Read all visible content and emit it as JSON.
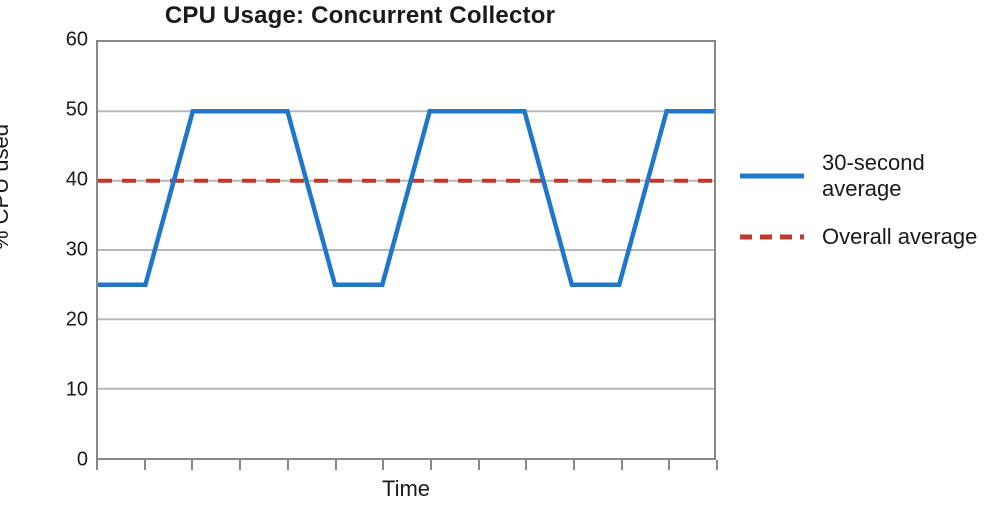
{
  "chart_data": {
    "type": "line",
    "title": "CPU Usage: Concurrent Collector",
    "xlabel": "Time",
    "ylabel": "% CPU used",
    "ylim": [
      0,
      60
    ],
    "y_ticks": [
      0,
      10,
      20,
      30,
      40,
      50,
      60
    ],
    "x_tick_count": 14,
    "series": [
      {
        "name": "30-second average",
        "style": "solid",
        "color": "#1f77c9",
        "x": [
          0,
          1,
          2,
          4,
          5,
          6,
          7,
          9,
          10,
          11,
          12,
          13
        ],
        "y": [
          25,
          25,
          50,
          50,
          25,
          25,
          50,
          50,
          25,
          25,
          50,
          50
        ]
      },
      {
        "name": "Overall average",
        "style": "dashed",
        "color": "#c0392b",
        "x": [
          0,
          13
        ],
        "y": [
          40,
          40
        ]
      }
    ],
    "xlim": [
      0,
      13
    ]
  },
  "title": "CPU Usage: Concurrent Collector",
  "ylabel": "% CPU used",
  "xlabel": "Time",
  "legend": {
    "s0": "30-second average",
    "s1": "Overall average"
  },
  "yticks": {
    "t60": "60",
    "t50": "50",
    "t40": "40",
    "t30": "30",
    "t20": "20",
    "t10": "10",
    "t0": "0"
  }
}
